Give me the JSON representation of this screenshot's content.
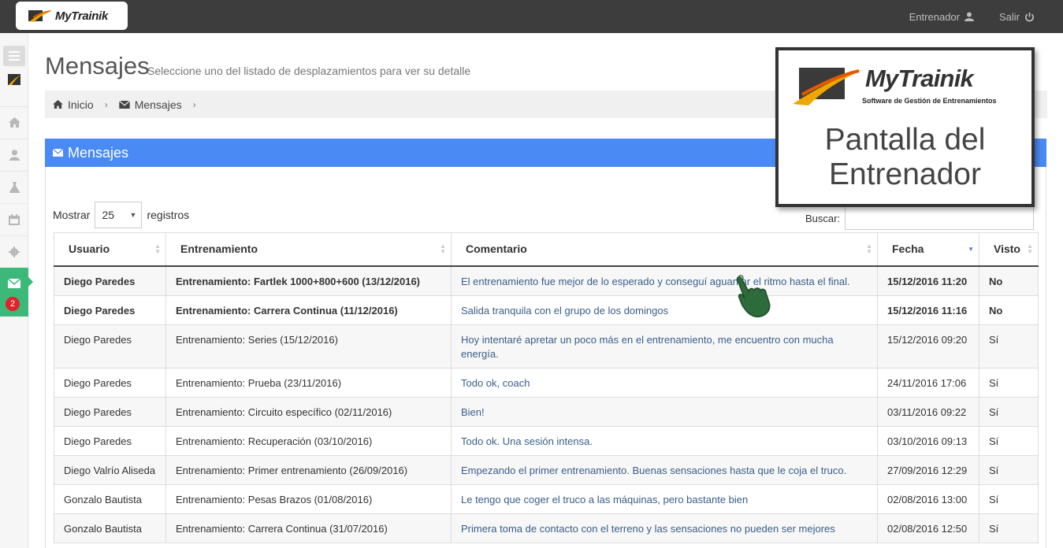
{
  "topbar": {
    "logo_text": "MyTrainik",
    "user_label": "Entrenador",
    "logout_label": "Salir"
  },
  "sidebar": {
    "badge_count": "2",
    "items": [
      "home-icon",
      "user-icon",
      "flask-icon",
      "calendar-icon",
      "gear-icon",
      "envelope-icon"
    ]
  },
  "header": {
    "title": "Mensajes",
    "subtitle": "Seleccione uno del listado de desplazamientos para ver su detalle"
  },
  "breadcrumb": {
    "home": "Inicio",
    "current": "Mensajes"
  },
  "panel": {
    "title": "Mensajes"
  },
  "controls": {
    "show_label": "Mostrar",
    "page_size": "25",
    "records_label": "registros",
    "search_label": "Buscar:"
  },
  "table": {
    "columns": [
      "Usuario",
      "Entrenamiento",
      "Comentario",
      "Fecha",
      "Visto"
    ],
    "rows": [
      {
        "user": "Diego Paredes",
        "training": "Entrenamiento: Fartlek 1000+800+600 (13/12/2016)",
        "comment": "El entrenamiento fue mejor de lo esperado y conseguí aguantar el ritmo hasta el final.",
        "date": "15/12/2016 11:20",
        "seen": "No"
      },
      {
        "user": "Diego Paredes",
        "training": "Entrenamiento: Carrera Continua (11/12/2016)",
        "comment": "Salida tranquila con el grupo de los domingos",
        "date": "15/12/2016 11:16",
        "seen": "No"
      },
      {
        "user": "Diego Paredes",
        "training": "Entrenamiento: Series (15/12/2016)",
        "comment": "Hoy intentaré apretar un poco más en el entrenamiento, me encuentro con mucha energía.",
        "date": "15/12/2016 09:20",
        "seen": "Sí"
      },
      {
        "user": "Diego Paredes",
        "training": "Entrenamiento: Prueba (23/11/2016)",
        "comment": "Todo ok, coach",
        "date": "24/11/2016 17:06",
        "seen": "Sí"
      },
      {
        "user": "Diego Paredes",
        "training": "Entrenamiento: Circuito específico (02/11/2016)",
        "comment": "Bien!",
        "date": "03/11/2016 09:22",
        "seen": "Sí"
      },
      {
        "user": "Diego Paredes",
        "training": "Entrenamiento: Recuperación (03/10/2016)",
        "comment": "Todo ok. Una sesión intensa.",
        "date": "03/10/2016 09:13",
        "seen": "Sí"
      },
      {
        "user": "Diego Valrío Aliseda",
        "training": "Entrenamiento: Primer entrenamiento (26/09/2016)",
        "comment": "Empezando el primer entrenamiento. Buenas sensaciones hasta que le coja el truco.",
        "date": "27/09/2016 12:29",
        "seen": "Sí"
      },
      {
        "user": "Gonzalo Bautista",
        "training": "Entrenamiento: Pesas Brazos (01/08/2016)",
        "comment": "Le tengo que coger el truco a las máquinas, pero bastante bien",
        "date": "02/08/2016 13:00",
        "seen": "Sí"
      },
      {
        "user": "Gonzalo Bautista",
        "training": "Entrenamiento: Carrera Continua (31/07/2016)",
        "comment": "Primera toma de contacto con el terreno y las sensaciones no pueden ser mejores",
        "date": "02/08/2016 12:50",
        "seen": "Sí"
      }
    ]
  },
  "promo": {
    "brand": "MyTrainik",
    "tagline": "Software de Gestión de Entrenamientos",
    "text_line1": "Pantalla del",
    "text_line2": "Entrenador"
  },
  "colors": {
    "topbar": "#3d3d3d",
    "accent_blue": "#4a8af4",
    "active_green": "#3cb878",
    "brand_orange": "#f0a500",
    "badge_red": "#e0232b"
  }
}
